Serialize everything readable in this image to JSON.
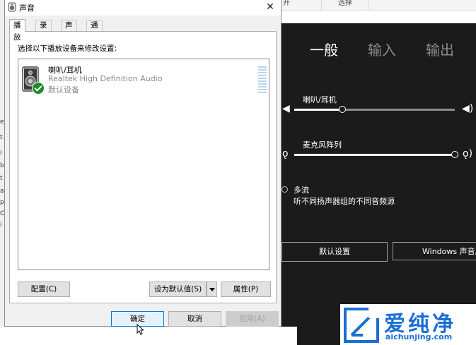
{
  "dialog": {
    "title": "声音",
    "tabs": [
      {
        "label": "播放",
        "active": true
      },
      {
        "label": "录制",
        "active": false
      },
      {
        "label": "声音",
        "active": false
      },
      {
        "label": "通信",
        "active": false
      }
    ],
    "instruction": "选择以下播放设备来修改设置:",
    "device": {
      "name": "喇叭/耳机",
      "driver": "Realtek High Definition Audio",
      "status": "默认设备"
    },
    "buttons": {
      "configure": "配置(C)",
      "set_default": "设为默认值(S)",
      "properties": "属性(P)",
      "ok": "确定",
      "cancel": "取消",
      "apply": "应用(A)"
    }
  },
  "background_window": {
    "top_cells": [
      "开",
      "选择"
    ],
    "tabs": [
      "一般",
      "输入",
      "输出"
    ],
    "active_tab": "一般",
    "sliders": [
      {
        "label": "喇叭/耳机",
        "level": 0.3
      },
      {
        "label": "麦克风阵列",
        "level": 1.0
      }
    ],
    "multistream": {
      "title": "多流",
      "description": "听不同扬声器组的不同音频源"
    },
    "buttons": {
      "default_settings": "默认设置",
      "windows_sound": "Windows 声音属"
    },
    "left_edge_chars": [
      "e",
      "t",
      "i",
      "b",
      "t",
      "a",
      "p",
      "C",
      "i"
    ]
  },
  "watermark": {
    "chinese": "爱纯净",
    "url": "aichunjing.com"
  },
  "colors": {
    "check_green": "#1e8c2e",
    "focus_blue": "#0078d7",
    "dark_bg": "#1b1b1b",
    "brand_blue": "#1b6fd1"
  }
}
